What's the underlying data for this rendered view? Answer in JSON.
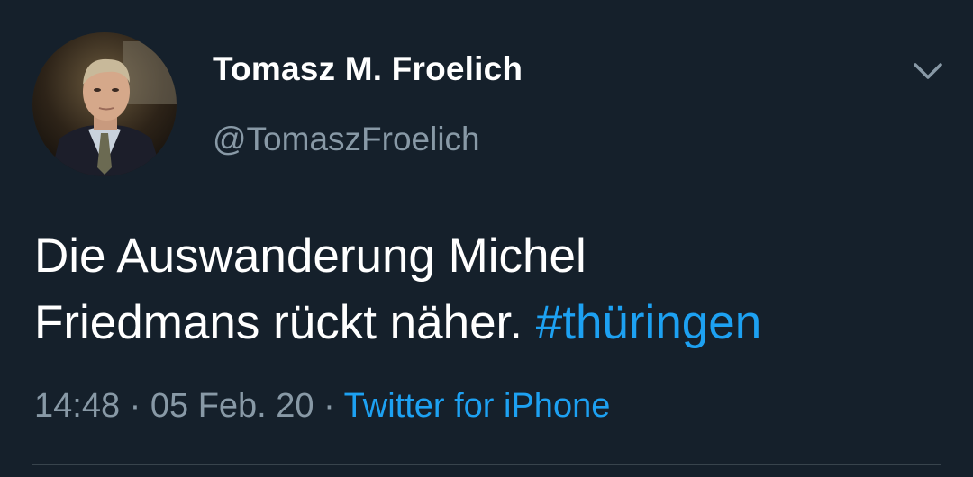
{
  "tweet": {
    "author": {
      "display_name": "Tomasz M. Froelich",
      "handle": "@TomaszFroelich",
      "avatar_icon": "profile-photo"
    },
    "menu_icon": "chevron-down-icon",
    "text_line_1": "Die Auswanderung Michel",
    "text_line_2": "Friedmans rückt näher.",
    "hashtag": "#thüringen",
    "time": "14:48",
    "separator": "·",
    "date": "05 Feb. 20",
    "source": "Twitter for iPhone"
  },
  "colors": {
    "background": "#15202b",
    "primary_text": "#ffffff",
    "secondary_text": "#8899a6",
    "accent": "#1da1f2",
    "divider": "#38444d"
  }
}
